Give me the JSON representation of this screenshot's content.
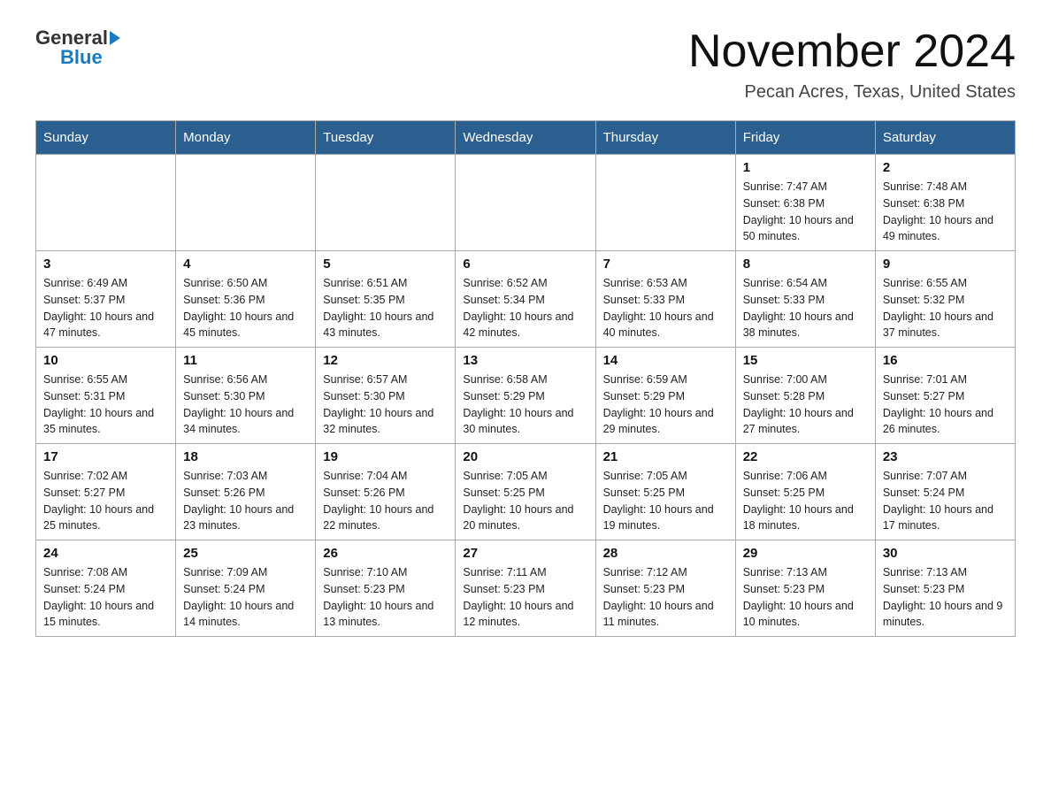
{
  "logo": {
    "general": "General",
    "blue": "Blue"
  },
  "title": "November 2024",
  "subtitle": "Pecan Acres, Texas, United States",
  "weekdays": [
    "Sunday",
    "Monday",
    "Tuesday",
    "Wednesday",
    "Thursday",
    "Friday",
    "Saturday"
  ],
  "weeks": [
    [
      {
        "day": "",
        "info": ""
      },
      {
        "day": "",
        "info": ""
      },
      {
        "day": "",
        "info": ""
      },
      {
        "day": "",
        "info": ""
      },
      {
        "day": "",
        "info": ""
      },
      {
        "day": "1",
        "info": "Sunrise: 7:47 AM\nSunset: 6:38 PM\nDaylight: 10 hours and 50 minutes."
      },
      {
        "day": "2",
        "info": "Sunrise: 7:48 AM\nSunset: 6:38 PM\nDaylight: 10 hours and 49 minutes."
      }
    ],
    [
      {
        "day": "3",
        "info": "Sunrise: 6:49 AM\nSunset: 5:37 PM\nDaylight: 10 hours and 47 minutes."
      },
      {
        "day": "4",
        "info": "Sunrise: 6:50 AM\nSunset: 5:36 PM\nDaylight: 10 hours and 45 minutes."
      },
      {
        "day": "5",
        "info": "Sunrise: 6:51 AM\nSunset: 5:35 PM\nDaylight: 10 hours and 43 minutes."
      },
      {
        "day": "6",
        "info": "Sunrise: 6:52 AM\nSunset: 5:34 PM\nDaylight: 10 hours and 42 minutes."
      },
      {
        "day": "7",
        "info": "Sunrise: 6:53 AM\nSunset: 5:33 PM\nDaylight: 10 hours and 40 minutes."
      },
      {
        "day": "8",
        "info": "Sunrise: 6:54 AM\nSunset: 5:33 PM\nDaylight: 10 hours and 38 minutes."
      },
      {
        "day": "9",
        "info": "Sunrise: 6:55 AM\nSunset: 5:32 PM\nDaylight: 10 hours and 37 minutes."
      }
    ],
    [
      {
        "day": "10",
        "info": "Sunrise: 6:55 AM\nSunset: 5:31 PM\nDaylight: 10 hours and 35 minutes."
      },
      {
        "day": "11",
        "info": "Sunrise: 6:56 AM\nSunset: 5:30 PM\nDaylight: 10 hours and 34 minutes."
      },
      {
        "day": "12",
        "info": "Sunrise: 6:57 AM\nSunset: 5:30 PM\nDaylight: 10 hours and 32 minutes."
      },
      {
        "day": "13",
        "info": "Sunrise: 6:58 AM\nSunset: 5:29 PM\nDaylight: 10 hours and 30 minutes."
      },
      {
        "day": "14",
        "info": "Sunrise: 6:59 AM\nSunset: 5:29 PM\nDaylight: 10 hours and 29 minutes."
      },
      {
        "day": "15",
        "info": "Sunrise: 7:00 AM\nSunset: 5:28 PM\nDaylight: 10 hours and 27 minutes."
      },
      {
        "day": "16",
        "info": "Sunrise: 7:01 AM\nSunset: 5:27 PM\nDaylight: 10 hours and 26 minutes."
      }
    ],
    [
      {
        "day": "17",
        "info": "Sunrise: 7:02 AM\nSunset: 5:27 PM\nDaylight: 10 hours and 25 minutes."
      },
      {
        "day": "18",
        "info": "Sunrise: 7:03 AM\nSunset: 5:26 PM\nDaylight: 10 hours and 23 minutes."
      },
      {
        "day": "19",
        "info": "Sunrise: 7:04 AM\nSunset: 5:26 PM\nDaylight: 10 hours and 22 minutes."
      },
      {
        "day": "20",
        "info": "Sunrise: 7:05 AM\nSunset: 5:25 PM\nDaylight: 10 hours and 20 minutes."
      },
      {
        "day": "21",
        "info": "Sunrise: 7:05 AM\nSunset: 5:25 PM\nDaylight: 10 hours and 19 minutes."
      },
      {
        "day": "22",
        "info": "Sunrise: 7:06 AM\nSunset: 5:25 PM\nDaylight: 10 hours and 18 minutes."
      },
      {
        "day": "23",
        "info": "Sunrise: 7:07 AM\nSunset: 5:24 PM\nDaylight: 10 hours and 17 minutes."
      }
    ],
    [
      {
        "day": "24",
        "info": "Sunrise: 7:08 AM\nSunset: 5:24 PM\nDaylight: 10 hours and 15 minutes."
      },
      {
        "day": "25",
        "info": "Sunrise: 7:09 AM\nSunset: 5:24 PM\nDaylight: 10 hours and 14 minutes."
      },
      {
        "day": "26",
        "info": "Sunrise: 7:10 AM\nSunset: 5:23 PM\nDaylight: 10 hours and 13 minutes."
      },
      {
        "day": "27",
        "info": "Sunrise: 7:11 AM\nSunset: 5:23 PM\nDaylight: 10 hours and 12 minutes."
      },
      {
        "day": "28",
        "info": "Sunrise: 7:12 AM\nSunset: 5:23 PM\nDaylight: 10 hours and 11 minutes."
      },
      {
        "day": "29",
        "info": "Sunrise: 7:13 AM\nSunset: 5:23 PM\nDaylight: 10 hours and 10 minutes."
      },
      {
        "day": "30",
        "info": "Sunrise: 7:13 AM\nSunset: 5:23 PM\nDaylight: 10 hours and 9 minutes."
      }
    ]
  ]
}
